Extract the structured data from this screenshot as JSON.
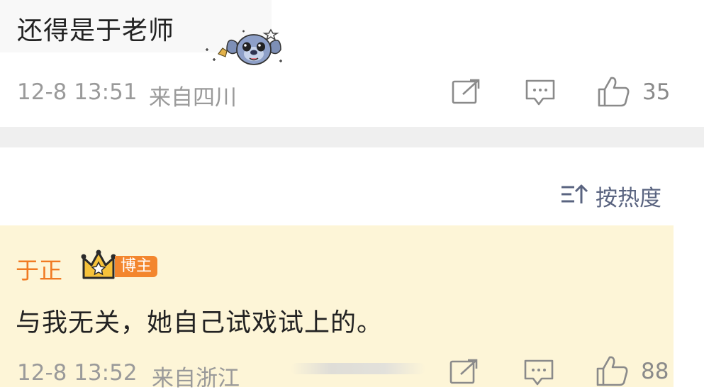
{
  "top_comment": {
    "text": "还得是于老师",
    "timestamp": "12-8 13:51",
    "location": "来自四川",
    "like_count": "35",
    "icons": [
      "share-icon",
      "comment-icon",
      "like-icon"
    ]
  },
  "sort": {
    "label": "按热度",
    "icon": "sort-icon"
  },
  "reply": {
    "author": "于正",
    "badge": "博主",
    "text": "与我无关，她自己试戏试上的。",
    "timestamp": "12-8 13:52",
    "location": "来自浙江",
    "like_count": "88",
    "icons": [
      "crown-icon",
      "share-icon",
      "comment-icon",
      "like-icon"
    ]
  },
  "colors": {
    "author": "#f07a22",
    "badge_bg": "#f3862e",
    "highlight_bg": "#fdf5d7",
    "meta_text": "#9a9a9a"
  }
}
